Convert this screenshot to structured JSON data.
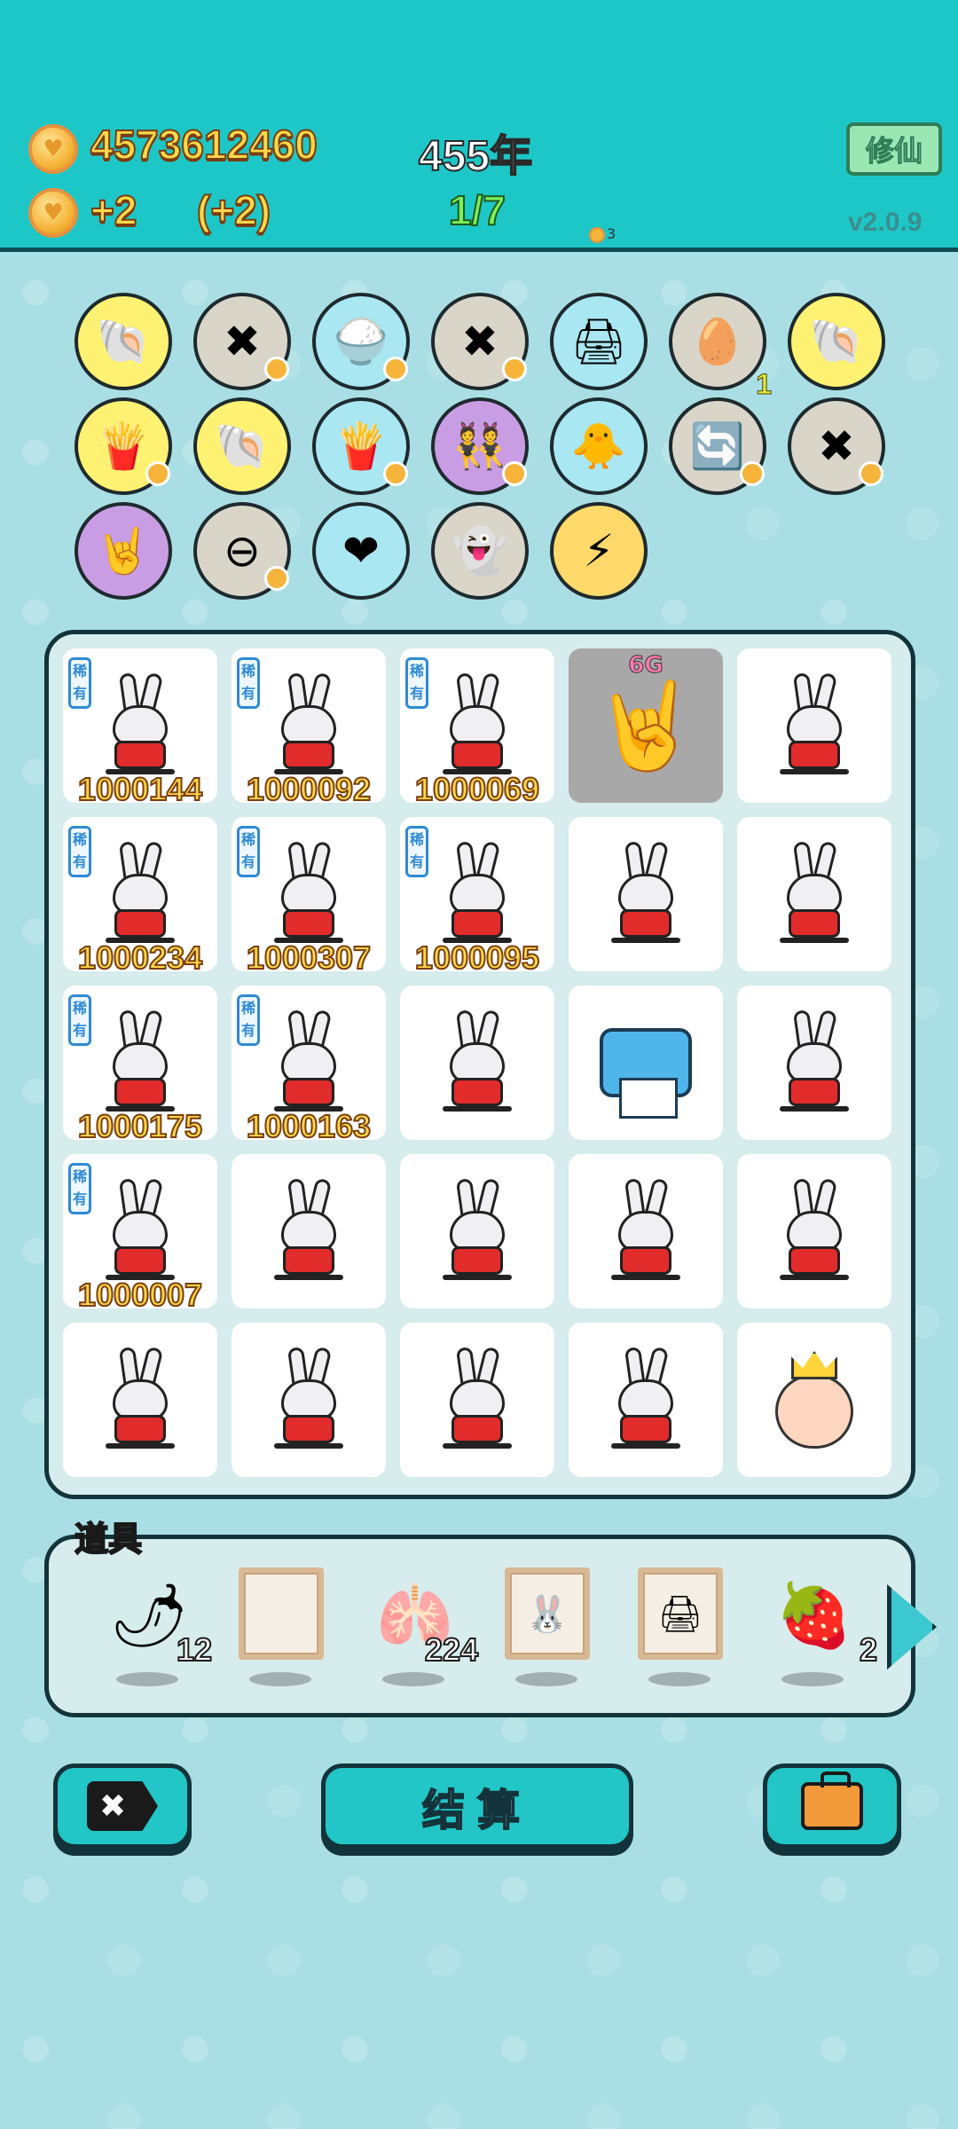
{
  "header": {
    "coins": "4573612460",
    "income": "+2",
    "income_bonus": "(+2)",
    "year": "455年",
    "progress": "1/7",
    "xiuxian_label": "修仙",
    "version": "v2.0.9",
    "tiny_coin_value": "3"
  },
  "relics": [
    {
      "icon": "shell-icon",
      "glyph": "🐚",
      "color": "yellow"
    },
    {
      "icon": "cancel-tag-icon",
      "glyph": "✖",
      "color": "gray",
      "coin": true
    },
    {
      "icon": "rice-bowl-icon",
      "glyph": "🍚",
      "color": "blue",
      "coin": true
    },
    {
      "icon": "cancel-tag-icon",
      "glyph": "✖",
      "color": "gray",
      "coin": true
    },
    {
      "icon": "printer-icon",
      "glyph": "🖨",
      "color": "blue",
      "warning": true
    },
    {
      "icon": "egg-tray-icon",
      "glyph": "🥚",
      "color": "gray",
      "count": "1"
    },
    {
      "icon": "shell-icon",
      "glyph": "🐚",
      "color": "yellow"
    },
    {
      "icon": "fries-icon",
      "glyph": "🍟",
      "color": "yellow",
      "coin": true
    },
    {
      "icon": "shell-icon",
      "glyph": "🐚",
      "color": "yellow"
    },
    {
      "icon": "fries-icon",
      "glyph": "🍟",
      "color": "blue",
      "coin": true
    },
    {
      "icon": "twins-icon",
      "glyph": "👯",
      "color": "purple",
      "coin": true
    },
    {
      "icon": "chick-egg-icon",
      "glyph": "🐥",
      "color": "blue"
    },
    {
      "icon": "refresh-icon",
      "glyph": "🔄",
      "color": "gray",
      "coin": true
    },
    {
      "icon": "cancel-tag-icon",
      "glyph": "✖",
      "color": "gray",
      "coin": true
    },
    {
      "icon": "rock-hand-icon",
      "glyph": "🤘",
      "color": "purple"
    },
    {
      "icon": "minus-circle-icon",
      "glyph": "⊖",
      "color": "gray",
      "coin": true
    },
    {
      "icon": "heart-fan-icon",
      "glyph": "❤",
      "color": "blue"
    },
    {
      "icon": "ghost-icon",
      "glyph": "👻",
      "color": "gray"
    },
    {
      "icon": "lightning-icon",
      "glyph": "⚡",
      "color": "orange"
    }
  ],
  "grid": {
    "rows": [
      [
        {
          "type": "rabbit",
          "rare": true,
          "value": "1000144"
        },
        {
          "type": "rabbit",
          "rare": true,
          "value": "1000092"
        },
        {
          "type": "rabbit",
          "rare": true,
          "value": "1000069"
        },
        {
          "type": "rock-hand",
          "label": "6G"
        },
        {
          "type": "rabbit"
        }
      ],
      [
        {
          "type": "rabbit",
          "rare": true,
          "value": "1000234"
        },
        {
          "type": "rabbit",
          "rare": true,
          "value": "1000307"
        },
        {
          "type": "rabbit",
          "rare": true,
          "value": "1000095"
        },
        {
          "type": "rabbit"
        },
        {
          "type": "rabbit"
        }
      ],
      [
        {
          "type": "rabbit",
          "rare": true,
          "value": "1000175"
        },
        {
          "type": "rabbit",
          "rare": true,
          "value": "1000163"
        },
        {
          "type": "rabbit"
        },
        {
          "type": "printer"
        },
        {
          "type": "rabbit"
        }
      ],
      [
        {
          "type": "rabbit",
          "rare": true,
          "value": "1000007"
        },
        {
          "type": "rabbit"
        },
        {
          "type": "rabbit"
        },
        {
          "type": "rabbit"
        },
        {
          "type": "rabbit"
        }
      ],
      [
        {
          "type": "rabbit"
        },
        {
          "type": "rabbit"
        },
        {
          "type": "rabbit"
        },
        {
          "type": "rabbit"
        },
        {
          "type": "king"
        }
      ]
    ],
    "rare_label": "稀有"
  },
  "props": {
    "title": "道具",
    "items": [
      {
        "icon": "chili-pepper-icon",
        "glyph": "🌶",
        "qty": "12"
      },
      {
        "icon": "empty-frame-icon",
        "frame": true,
        "qty": ""
      },
      {
        "icon": "liver-icon",
        "glyph": "🫁",
        "qty": "224"
      },
      {
        "icon": "rabbit-frame-icon",
        "frame": true,
        "inner": "🐰",
        "qty": ""
      },
      {
        "icon": "printer-frame-icon",
        "frame": true,
        "inner": "🖨",
        "qty": ""
      },
      {
        "icon": "strawberry-icon",
        "glyph": "🍓",
        "qty": "2"
      }
    ]
  },
  "buttons": {
    "settle": "结算",
    "cancel_glyph": "✖"
  }
}
